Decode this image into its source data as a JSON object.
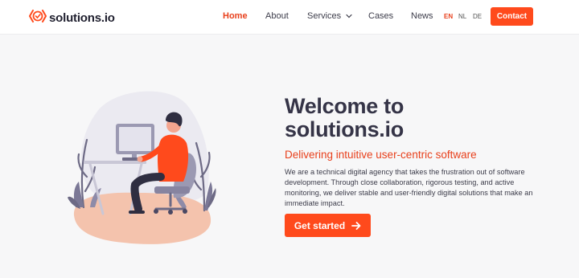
{
  "brand": {
    "name": "solutions.io",
    "accent": "#ff4a1c"
  },
  "nav": {
    "items": [
      {
        "label": "Home",
        "active": true
      },
      {
        "label": "About"
      },
      {
        "label": "Services",
        "has_dropdown": true
      },
      {
        "label": "Cases"
      },
      {
        "label": "News"
      }
    ],
    "languages": [
      {
        "code": "EN",
        "active": true
      },
      {
        "code": "NL"
      },
      {
        "code": "DE"
      }
    ],
    "contact_label": "Contact"
  },
  "hero": {
    "title_line1": "Welcome to",
    "title_line2": "solutions.io",
    "subtitle": "Delivering intuitive user-centric software",
    "body": "We are a technical digital agency that takes the frustration out of software development. Through close collaboration, rigorous testing, and active monitoring, we deliver stable and user-friendly digital solutions that make an immediate impact.",
    "cta_label": "Get started",
    "illustration": "person-at-desk-illustration"
  },
  "icons": {
    "logo": "logo-mark-icon",
    "dropdown": "chevron-down-icon",
    "cta": "arrow-right-icon"
  }
}
